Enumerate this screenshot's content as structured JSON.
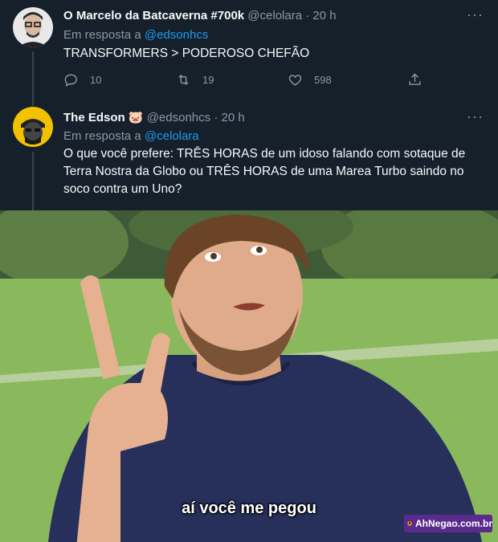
{
  "tweets": [
    {
      "name": "O Marcelo da Batcaverna #700k",
      "handle": "@celolara",
      "sep": "·",
      "time": "20 h",
      "more": "···",
      "reply_prefix": "Em resposta a",
      "reply_to": "@edsonhcs",
      "text": "TRANSFORMERS > PODEROSO CHEFÃO",
      "replies": "10",
      "retweets": "19",
      "likes": "598"
    },
    {
      "name": "The Edson",
      "name_emoji": "🐷",
      "handle": "@edsonhcs",
      "sep": "·",
      "time": "20 h",
      "more": "···",
      "reply_prefix": "Em resposta a",
      "reply_to": "@celolara",
      "text_lines": [
        "O que você prefere: TRÊS HORAS de um idoso falando com sotaque de",
        "Terra Nostra da Globo ou TRÊS HORAS de uma Marea  Turbo saindo no",
        "soco contra um Uno?"
      ]
    }
  ],
  "meme": {
    "caption": "aí você me pegou",
    "watermark": "AhNegao.com.br"
  },
  "colors": {
    "background": "#15202b",
    "accent": "#1d9bf0",
    "muted": "#8b98a5",
    "watermark_bg": "#5a2b8c"
  },
  "icons": [
    "reply-icon",
    "retweet-icon",
    "like-icon",
    "share-icon",
    "more-icon",
    "pig-emoji"
  ]
}
